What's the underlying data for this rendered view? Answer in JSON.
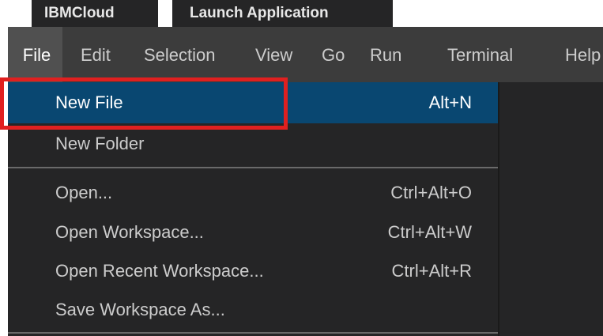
{
  "tabs": {
    "ibmcloud": "IBMCloud",
    "launch": "Launch Application"
  },
  "menubar": {
    "items": [
      "File",
      "Edit",
      "Selection",
      "View",
      "Go",
      "Run",
      "Terminal",
      "Help"
    ],
    "active": "File"
  },
  "file_menu": {
    "items": [
      {
        "label": "New File",
        "shortcut": "Alt+N",
        "selected": true
      },
      {
        "label": "New Folder",
        "shortcut": ""
      },
      {
        "label": "Open...",
        "shortcut": "Ctrl+Alt+O"
      },
      {
        "label": "Open Workspace...",
        "shortcut": "Ctrl+Alt+W"
      },
      {
        "label": "Open Recent Workspace...",
        "shortcut": "Ctrl+Alt+R"
      },
      {
        "label": "Save Workspace As...",
        "shortcut": ""
      }
    ]
  },
  "colors": {
    "menubar_bg": "#3c3c3c",
    "menu_bg": "#252526",
    "selected_bg": "#094771",
    "highlight_border": "#e02020"
  }
}
